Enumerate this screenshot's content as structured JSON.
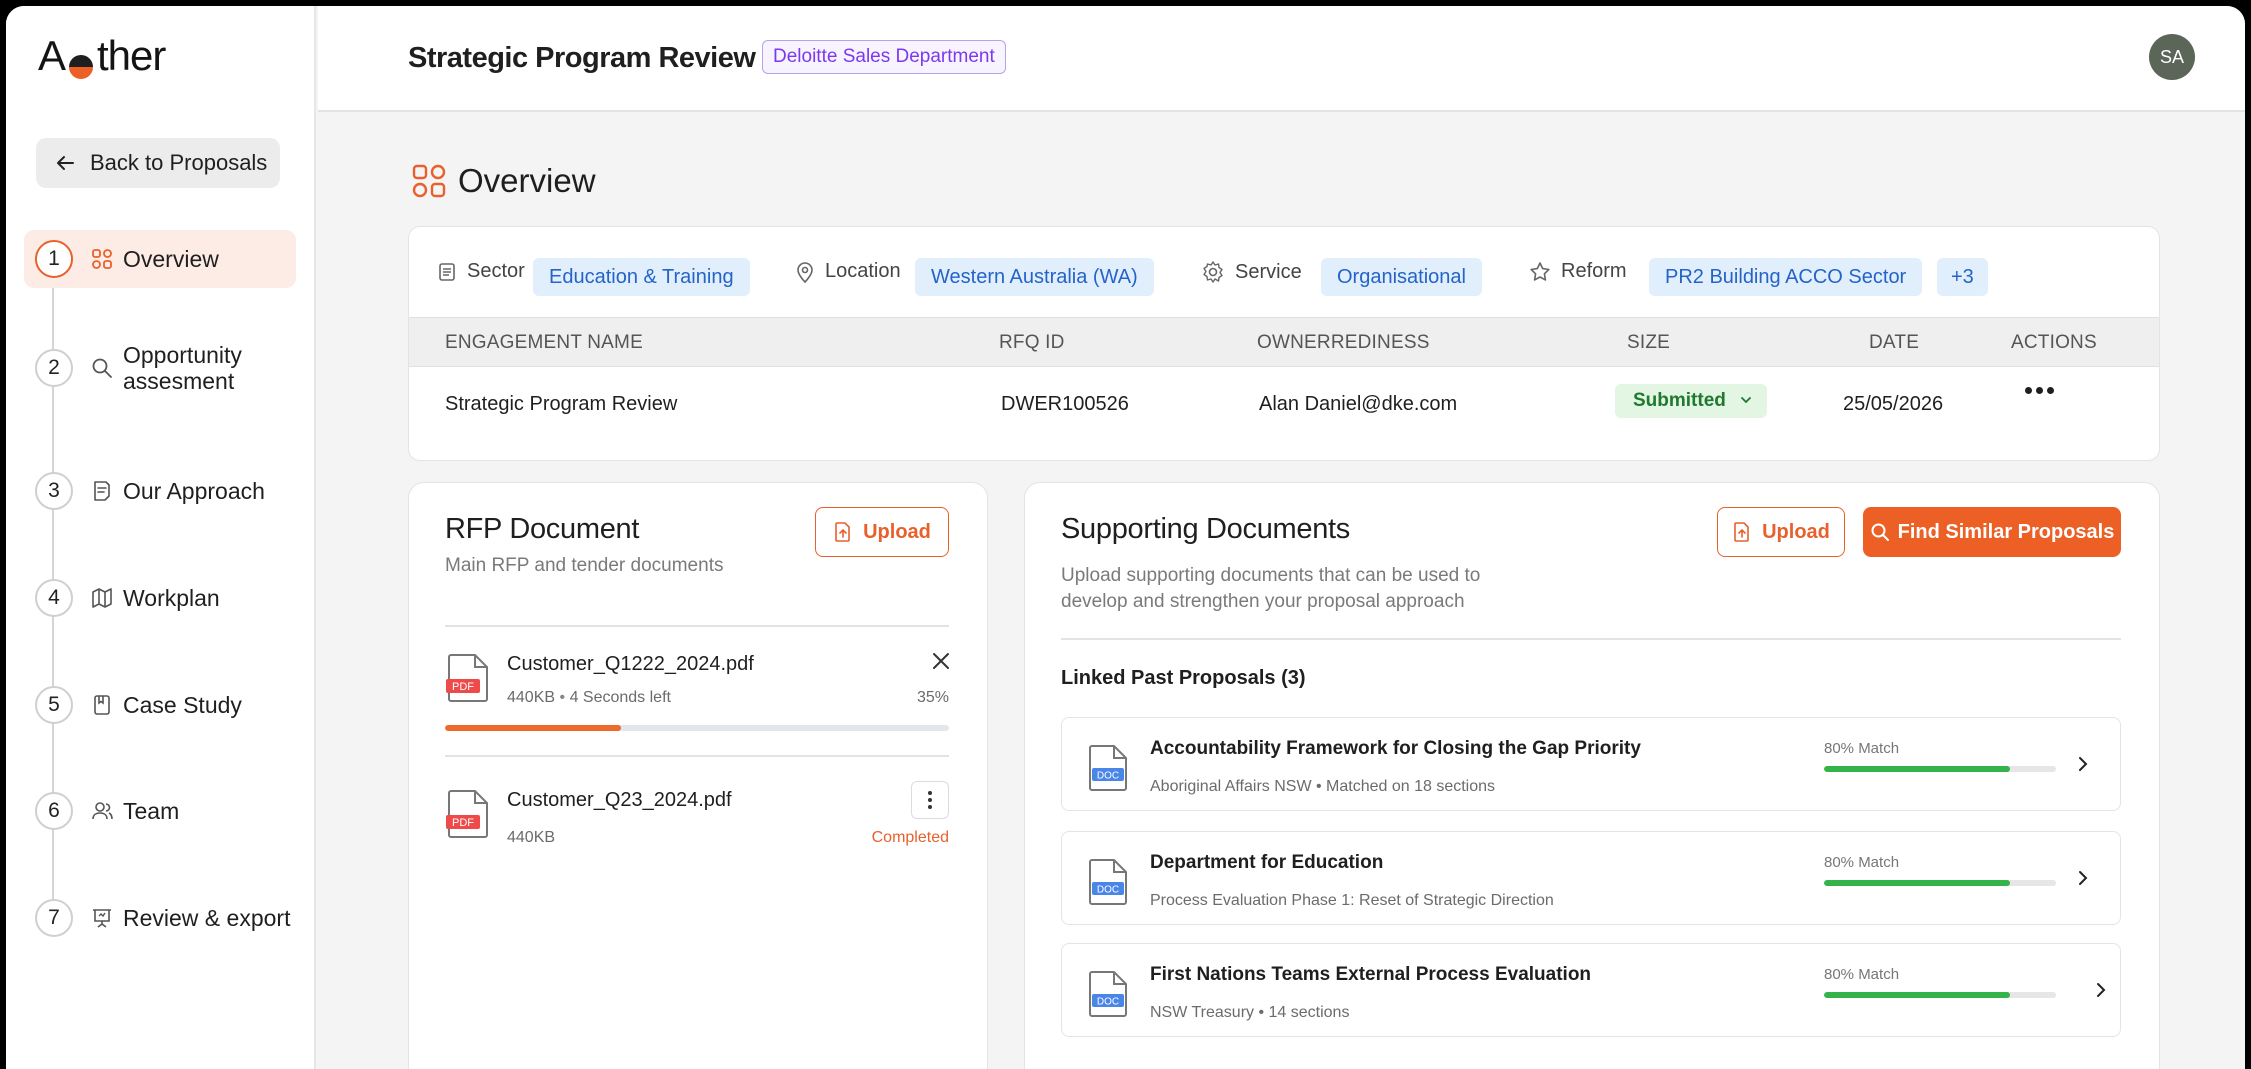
{
  "brand": {
    "logo_before": "A",
    "logo_after": "ther",
    "logo_full": "Aether"
  },
  "sidebar": {
    "back_label": "Back to Proposals",
    "steps": [
      {
        "num": "1",
        "label": "Overview",
        "icon": "grid-icon"
      },
      {
        "num": "2",
        "label": "Opportunity assesment",
        "icon": "search-icon"
      },
      {
        "num": "3",
        "label": "Our Approach",
        "icon": "document-icon"
      },
      {
        "num": "4",
        "label": "Workplan",
        "icon": "map-icon"
      },
      {
        "num": "5",
        "label": "Case Study",
        "icon": "notebook-icon"
      },
      {
        "num": "6",
        "label": "Team",
        "icon": "users-icon"
      },
      {
        "num": "7",
        "label": "Review & export",
        "icon": "presentation-icon"
      }
    ],
    "active_step": 0
  },
  "header": {
    "title": "Strategic Program Review",
    "department": "Deloitte Sales Department",
    "avatar_initials": "SA"
  },
  "overview": {
    "heading": "Overview",
    "meta": {
      "sector_label": "Sector",
      "sector_value": "Education & Training",
      "location_label": "Location",
      "location_value": "Western Australia (WA)",
      "service_label": "Service",
      "service_value": "Organisational",
      "reform_label": "Reform",
      "reform_value": "PR2 Building ACCO Sector",
      "more": "+3"
    },
    "columns": [
      "ENGAGEMENT NAME",
      "RFQ ID",
      "OWNERREDINESS",
      "SIZE",
      "DATE",
      "ACTIONS"
    ],
    "row": {
      "engagement_name": "Strategic Program Review",
      "rfq_id": "DWER100526",
      "owner": "Alan Daniel@dke.com",
      "status": "Submitted",
      "date": "25/05/2026"
    }
  },
  "rfp": {
    "title": "RFP Document",
    "subtitle": "Main RFP and tender documents",
    "upload_label": "Upload",
    "files": [
      {
        "name": "Customer_Q1222_2024.pdf",
        "size": "440KB",
        "eta": "4 Seconds left",
        "progress_text": "35%",
        "progress": 0.35,
        "badge": "PDF"
      },
      {
        "name": "Customer_Q23_2024.pdf",
        "size": "440KB",
        "status": "Completed",
        "badge": "PDF"
      }
    ]
  },
  "supporting": {
    "title": "Supporting Documents",
    "subtitle_line1": "Upload supporting documents that can be used to",
    "subtitle_line2": "develop and strengthen your proposal approach",
    "upload_label": "Upload",
    "find_label": "Find Similar Proposals",
    "linked_title": "Linked Past Proposals (3)",
    "proposals": [
      {
        "title": "Accountability Framework for Closing the Gap Priority",
        "sub": "Aboriginal Affairs NSW • Matched on 18 sections",
        "match": "80% Match",
        "value": 0.8,
        "badge": "DOC"
      },
      {
        "title": "Department for Education",
        "sub": "Process Evaluation Phase 1: Reset of Strategic Direction",
        "match": "80% Match",
        "value": 0.8,
        "badge": "DOC"
      },
      {
        "title": "First Nations Teams External Process Evaluation",
        "sub": "NSW Treasury • 14 sections",
        "match": "80% Match",
        "value": 0.8,
        "badge": "DOC"
      }
    ]
  },
  "colors": {
    "accent": "#ec5f25",
    "chip_bg": "#e1effc",
    "chip_text": "#2563c9",
    "success": "#34b34a",
    "status_bg": "#e3f5e3"
  }
}
